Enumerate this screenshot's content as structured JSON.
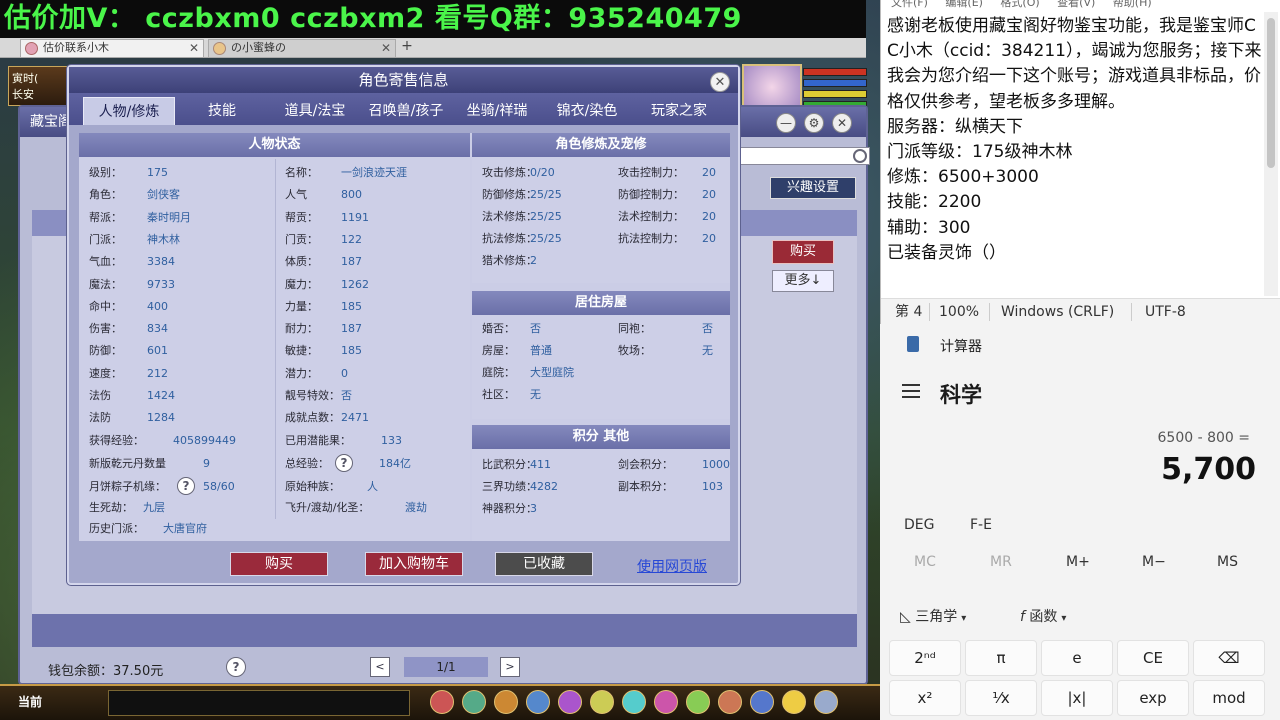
{
  "banner": {
    "text": "估价加V：  cczbxm0   cczbxm2   看号Q群：935240479"
  },
  "browser": {
    "tabs": [
      {
        "label": "估价联系小木"
      },
      {
        "label": "の小蜜蜂の"
      }
    ],
    "new_tab": "+"
  },
  "game_hud": {
    "left_text": "寅时(",
    "left_text2": "长安"
  },
  "back_window": {
    "title": "藏宝阁",
    "interest_button": "兴趣设置",
    "buy_button": "购买",
    "more_button": "更多↓",
    "wallet": "钱包余额：37.50元",
    "help": "?",
    "page": "1/1",
    "prev": "<",
    "next": ">"
  },
  "dialog": {
    "title": "角色寄售信息",
    "close": "✕",
    "tabs": [
      {
        "label": "人物/修炼"
      },
      {
        "label": "技能"
      },
      {
        "label": "道具/法宝"
      },
      {
        "label": "召唤兽/孩子"
      },
      {
        "label": "坐骑/祥瑞"
      },
      {
        "label": "锦衣/染色"
      },
      {
        "label": "玩家之家"
      }
    ],
    "status_panel": {
      "title": "人物状态",
      "left": [
        {
          "label": "级别：",
          "value": "175"
        },
        {
          "label": "角色：",
          "value": "剑侠客"
        },
        {
          "label": "帮派：",
          "value": "秦时明月"
        },
        {
          "label": "门派：",
          "value": "神木林"
        },
        {
          "label": "气血：",
          "value": "3384"
        },
        {
          "label": "魔法：",
          "value": "9733"
        },
        {
          "label": "命中：",
          "value": "400"
        },
        {
          "label": "伤害：",
          "value": "834"
        },
        {
          "label": "防御：",
          "value": "601"
        },
        {
          "label": "速度：",
          "value": "212"
        },
        {
          "label": "法伤",
          "value": "1424"
        },
        {
          "label": "法防",
          "value": "1284"
        }
      ],
      "right": [
        {
          "label": "名称：",
          "value": "一剑浪迹天涯"
        },
        {
          "label": "人气",
          "value": "800"
        },
        {
          "label": "帮贡：",
          "value": "1191"
        },
        {
          "label": "门贡：",
          "value": "122"
        },
        {
          "label": "体质：",
          "value": "187"
        },
        {
          "label": "魔力：",
          "value": "1262"
        },
        {
          "label": "力量：",
          "value": "185"
        },
        {
          "label": "耐力：",
          "value": "187"
        },
        {
          "label": "敏捷：",
          "value": "185"
        },
        {
          "label": "潜力：",
          "value": "0"
        },
        {
          "label": "靓号特效：",
          "value": "否"
        },
        {
          "label": "成就点数：",
          "value": "2471"
        }
      ],
      "extra": [
        {
          "label": "获得经验：",
          "value": "405899449"
        },
        {
          "label": "已用潜能果：",
          "value": "133"
        },
        {
          "label": "新版乾元丹数量",
          "value": "9"
        },
        {
          "label": "总经验：",
          "value": "184亿"
        },
        {
          "label": "月饼粽子机缘：",
          "value": "58/60"
        },
        {
          "label": "原始种族：",
          "value": "人"
        },
        {
          "label": "生死劫：",
          "value": "九层"
        },
        {
          "label": "飞升/渡劫/化圣：",
          "value": "渡劫"
        },
        {
          "label": "历史门派：",
          "value": "大唐官府"
        }
      ],
      "help": "?"
    },
    "cultivation_panel": {
      "title": "角色修炼及宠修",
      "rows": [
        {
          "l1": "攻击修炼：",
          "v1": "0/20",
          "l2": "攻击控制力：",
          "v2": "20"
        },
        {
          "l1": "防御修炼：",
          "v1": "25/25",
          "l2": "防御控制力：",
          "v2": "20"
        },
        {
          "l1": "法术修炼：",
          "v1": "25/25",
          "l2": "法术控制力：",
          "v2": "20"
        },
        {
          "l1": "抗法修炼：",
          "v1": "25/25",
          "l2": "抗法控制力：",
          "v2": "20"
        },
        {
          "l1": "猎术修炼：",
          "v1": "2",
          "l2": "",
          "v2": ""
        }
      ]
    },
    "house_panel": {
      "title": "居住房屋",
      "rows": [
        {
          "l1": "婚否：",
          "v1": "否",
          "l2": "同袍：",
          "v2": "否"
        },
        {
          "l1": "房屋：",
          "v1": "普通",
          "l2": "牧场：",
          "v2": "无"
        },
        {
          "l1": "庭院：",
          "v1": "大型庭院",
          "l2": "",
          "v2": ""
        },
        {
          "l1": "社区：",
          "v1": "无",
          "l2": "",
          "v2": ""
        }
      ]
    },
    "points_panel": {
      "title": "积分 其他",
      "rows": [
        {
          "l1": "比武积分：",
          "v1": "411",
          "l2": "剑会积分：",
          "v2": "1000"
        },
        {
          "l1": "三界功绩：",
          "v1": "4282",
          "l2": "副本积分：",
          "v2": "103"
        },
        {
          "l1": "神器积分：",
          "v1": "3",
          "l2": "",
          "v2": ""
        }
      ]
    },
    "buttons": {
      "buy": "购买",
      "cart": "加入购物车",
      "fav": "已收藏",
      "web": "使用网页版"
    }
  },
  "game_bottom": {
    "label": "当前"
  },
  "notepad": {
    "menu": "文件(F)  编辑(E)  格式(O)  查看(V)  帮助(H)",
    "text": "感谢老板使用藏宝阁好物鉴宝功能，我是鉴宝师CC小木（ccid：38​​4211），竭诚为您服务；接下来我会为您介绍一下这个账号；游戏道具非标品，价格仅供参考，望老板多多理解。\n服务器：纵横天下\n门派等级：175级神木林\n修炼：6500+3000\n技能：2200\n辅助：300\n已装备灵饰（）",
    "status": {
      "line": "第 4",
      "zoom": "100%",
      "eol": "Windows (CRLF)",
      "encoding": "UTF-8"
    }
  },
  "calculator": {
    "title": "计算器",
    "mode": "科学",
    "expression": "6500 - 800 =",
    "result": "5,700",
    "flags": [
      "DEG",
      "F-E"
    ],
    "memory": [
      "MC",
      "MR",
      "M+",
      "M−",
      "MS"
    ],
    "sub_menus": [
      "三角学",
      "函数"
    ],
    "keys": [
      "2ⁿᵈ",
      "π",
      "e",
      "CE",
      "⌫",
      "x²",
      "¹⁄x",
      "|x|",
      "exp",
      "mod"
    ]
  }
}
